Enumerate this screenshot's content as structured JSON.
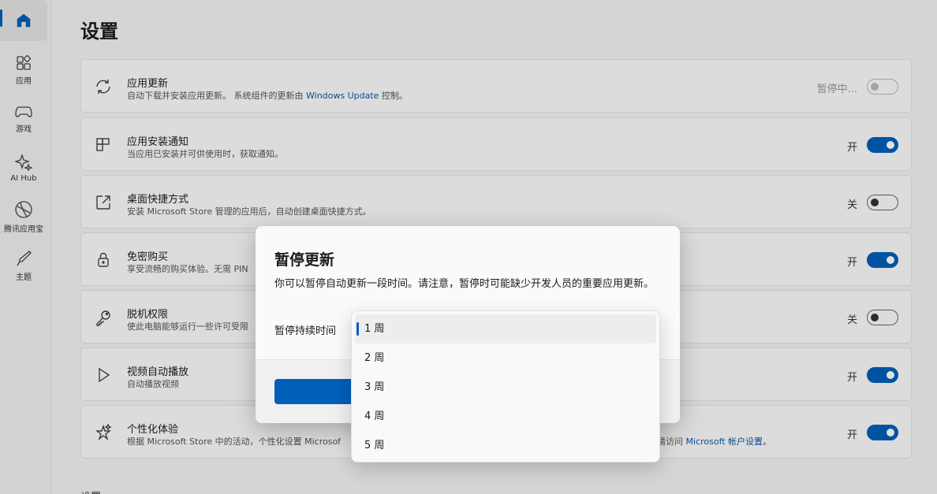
{
  "sidebar": {
    "items": [
      {
        "key": "home",
        "icon": "home-icon",
        "label": ""
      },
      {
        "key": "apps",
        "icon": "apps-grid-icon",
        "label": "应用"
      },
      {
        "key": "games",
        "icon": "gamepad-icon",
        "label": "游戏"
      },
      {
        "key": "ai",
        "icon": "sparkle-icon",
        "label": "AI Hub"
      },
      {
        "key": "tencent",
        "icon": "tencent-store-icon",
        "label": "腾讯应用宝"
      },
      {
        "key": "theme",
        "icon": "brush-icon",
        "label": "主题"
      }
    ]
  },
  "page": {
    "title": "设置",
    "next_section_hint": "设置"
  },
  "settings": [
    {
      "icon": "refresh-icon",
      "title": "应用更新",
      "desc_before": "自动下载并安装应用更新。 系统组件的更新由 ",
      "desc_link": "Windows Update",
      "desc_after": " 控制。",
      "state": "暂停中...",
      "on": false
    },
    {
      "icon": "app-install-icon",
      "title": "应用安装通知",
      "desc_before": "当应用已安装并可供使用时，获取通知。",
      "desc_link": "",
      "desc_after": "",
      "state": "开",
      "on": true
    },
    {
      "icon": "shortcut-icon",
      "title": "桌面快捷方式",
      "desc_before": "安装 Microsoft Store 管理的应用后，自动创建桌面快捷方式。",
      "desc_link": "",
      "desc_after": "",
      "state": "关",
      "on": false
    },
    {
      "icon": "lock-icon",
      "title": "免密购买",
      "desc_before": "享受流畅的购买体验。无需 PIN",
      "desc_link": "",
      "desc_after": "",
      "state": "开",
      "on": true
    },
    {
      "icon": "key-icon",
      "title": "脱机权限",
      "desc_before": "使此电脑能够运行一些许可受限",
      "desc_link": "",
      "desc_after": "",
      "state": "关",
      "on": false
    },
    {
      "icon": "play-icon",
      "title": "视频自动播放",
      "desc_before": "自动播放视频",
      "desc_link": "",
      "desc_after": "",
      "state": "开",
      "on": true
    },
    {
      "icon": "personalize-star-icon",
      "title": "个性化体验",
      "desc_before": "根据 Microsoft Store 中的活动，个性化设置 Microsof",
      "desc_link": "",
      "desc_after": "",
      "desc_right": "请访问 ",
      "desc_right_link": "Microsoft 帐户设置",
      "desc_right_after": "。",
      "state": "开",
      "on": true
    }
  ],
  "dialog": {
    "title": "暂停更新",
    "description": "你可以暂停自动更新一段时间。请注意，暂停时可能缺少开发人员的重要应用更新。",
    "duration_label": "暂停持续时间",
    "options": [
      "1 周",
      "2 周",
      "3 周",
      "4 周",
      "5 周"
    ],
    "selected_index": 0
  },
  "colors": {
    "accent": "#005fb8",
    "link": "#0b57a6"
  }
}
